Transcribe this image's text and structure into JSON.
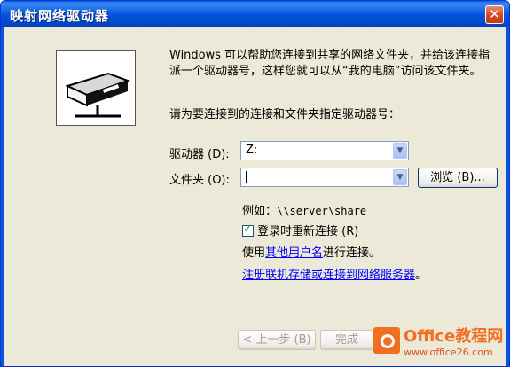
{
  "window": {
    "title": "映射网络驱动器",
    "close_glyph": "✕"
  },
  "description": "Windows 可以帮助您连接到共享的网络文件夹，并给该连接指派一个驱动器号，这样您就可以从“我的电脑”访问该文件夹。",
  "instruction": "请为要连接到的连接和文件夹指定驱动器号：",
  "drive": {
    "label": "驱动器 (D):",
    "value": "Z:"
  },
  "folder": {
    "label": "文件夹 (O):",
    "value": "",
    "browse_label": "浏览 (B)..."
  },
  "example": {
    "prefix": "例如：",
    "path": "\\\\server\\share"
  },
  "reconnect": {
    "label": "登录时重新连接 (R)",
    "checked": true
  },
  "other_user": {
    "before": "使用",
    "link": "其他用户名",
    "after": "进行连接。"
  },
  "signup": {
    "link": "注册联机存储或连接到网络服务器",
    "after": "。"
  },
  "footer": {
    "back_label": "< 上一步 (B)",
    "finish_label": "完成"
  },
  "watermark": {
    "brand": "Office教程网",
    "url": "www.office26.com"
  },
  "colors": {
    "titlebar": "#0855dd",
    "dialog_bg": "#ece9d8",
    "close_button": "#d5451c",
    "link": "#0000ff",
    "watermark": "#f26e21"
  },
  "icons": {
    "wizard_illustration": "network-drive-icon",
    "combo_arrow": "chevron-down-icon",
    "check": "checkmark-icon"
  }
}
